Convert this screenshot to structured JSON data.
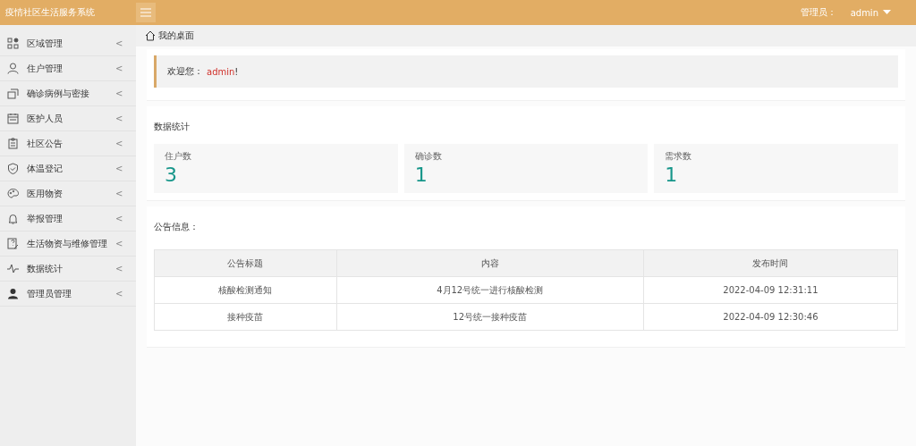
{
  "header": {
    "title": "疫情社区生活服务系统",
    "user_label": "管理员：",
    "user_name": "admin"
  },
  "sidebar": {
    "items": [
      {
        "label": "区域管理",
        "arrow": "<"
      },
      {
        "label": "住户管理",
        "arrow": "<"
      },
      {
        "label": "确诊病例与密接",
        "arrow": "<"
      },
      {
        "label": "医护人员",
        "arrow": "<"
      },
      {
        "label": "社区公告",
        "arrow": "<"
      },
      {
        "label": "体温登记",
        "arrow": "<"
      },
      {
        "label": "医用物资",
        "arrow": "<"
      },
      {
        "label": "举报管理",
        "arrow": "<"
      },
      {
        "label": "生活物资与维修管理",
        "arrow": "<"
      },
      {
        "label": "数据统计",
        "arrow": "<"
      },
      {
        "label": "管理员管理",
        "arrow": "<"
      }
    ]
  },
  "breadcrumb": "我的桌面",
  "welcome": {
    "text": "欢迎您：",
    "name": "admin",
    "mark": "!"
  },
  "stats": {
    "title": "数据统计",
    "cards": [
      {
        "label": "住户数",
        "value": "3"
      },
      {
        "label": "确诊数",
        "value": "1"
      },
      {
        "label": "需求数",
        "value": "1"
      }
    ]
  },
  "notices": {
    "title": "公告信息：",
    "columns": [
      "公告标题",
      "内容",
      "发布时间"
    ],
    "rows": [
      [
        "核酸检测通知",
        "4月12号统一进行核酸检测",
        "2022-04-09 12:31:11"
      ],
      [
        "接种疫苗",
        "12号统一接种疫苗",
        "2022-04-09 12:30:46"
      ]
    ]
  }
}
